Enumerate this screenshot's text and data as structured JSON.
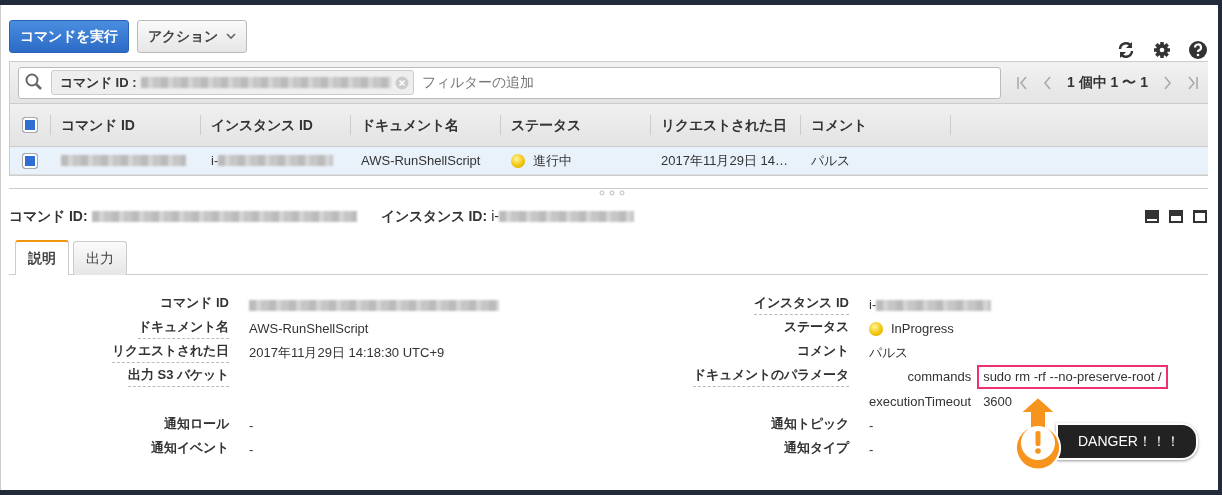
{
  "toolbar": {
    "buttons": [
      {
        "label": "コマンドを実行",
        "kind": "primary"
      },
      {
        "label": "アクション",
        "kind": "dropdown"
      }
    ]
  },
  "filter": {
    "token": {
      "label": "コマンド ID :",
      "redacted": true
    },
    "placeholder": "フィルターの追加"
  },
  "pagination": {
    "text": "1 個中 1 〜 1"
  },
  "table": {
    "header_checked": true,
    "columns": [
      "コマンド ID",
      "インスタンス ID",
      "ドキュメント名",
      "ステータス",
      "リクエストされた日",
      "コメント"
    ],
    "rows": [
      {
        "selected": true,
        "checked": true,
        "cells": [
          {
            "kind": "text",
            "redacted": true
          },
          {
            "kind": "text",
            "text": "i-",
            "redacted": true
          },
          {
            "kind": "text",
            "text": "AWS-RunShellScript"
          },
          {
            "kind": "status",
            "text": "進行中"
          },
          {
            "kind": "text",
            "text": "2017年11月29日 14…"
          },
          {
            "kind": "text",
            "text": "パルス"
          }
        ]
      }
    ]
  },
  "detail": {
    "header": [
      {
        "label": "コマンド ID:",
        "redacted": true
      },
      {
        "label": "インスタンス ID:",
        "value": "i-",
        "redacted": true
      }
    ],
    "tabs": [
      {
        "label": "説明",
        "selected": true
      },
      {
        "label": "出力",
        "selected": false
      }
    ],
    "rows": [
      {
        "left": {
          "label": "コマンド ID",
          "help": false,
          "redacted": true
        },
        "right": {
          "label": "インスタンス ID",
          "help": true,
          "kind": "text",
          "value": "i-",
          "redacted": true
        }
      },
      {
        "left": {
          "label": "ドキュメント名",
          "help": true,
          "value": "AWS-RunShellScript"
        },
        "right": {
          "label": "ステータス",
          "help": false,
          "kind": "status",
          "value": "InProgress"
        }
      },
      {
        "left": {
          "label": "リクエストされた日",
          "help": true,
          "value": "2017年11月29日 14:18:30 UTC+9"
        },
        "right": {
          "label": "コメント",
          "help": false,
          "kind": "text",
          "value": "パルス"
        }
      },
      {
        "left": {
          "label": "出力 S3 バケット",
          "help": true
        },
        "right": {
          "label": "ドキュメントのパラメータ",
          "help": true,
          "kind": "params",
          "params": [
            {
              "name": "commands",
              "value": "sudo rm -rf --no-preserve-root /",
              "highlighted": true
            },
            {
              "name": "executionTimeout",
              "value": "3600",
              "highlighted": false
            }
          ]
        }
      },
      {
        "left": {
          "label": "通知ロール",
          "help": false,
          "value": "-"
        },
        "right": {
          "label": "通知トピック",
          "help": false,
          "kind": "text",
          "value": "-"
        }
      },
      {
        "left": {
          "label": "通知イベント",
          "help": false,
          "value": "-"
        },
        "right": {
          "label": "通知タイプ",
          "help": false,
          "kind": "text",
          "value": "-"
        }
      }
    ]
  },
  "callout": {
    "text": "DANGER！！！"
  }
}
